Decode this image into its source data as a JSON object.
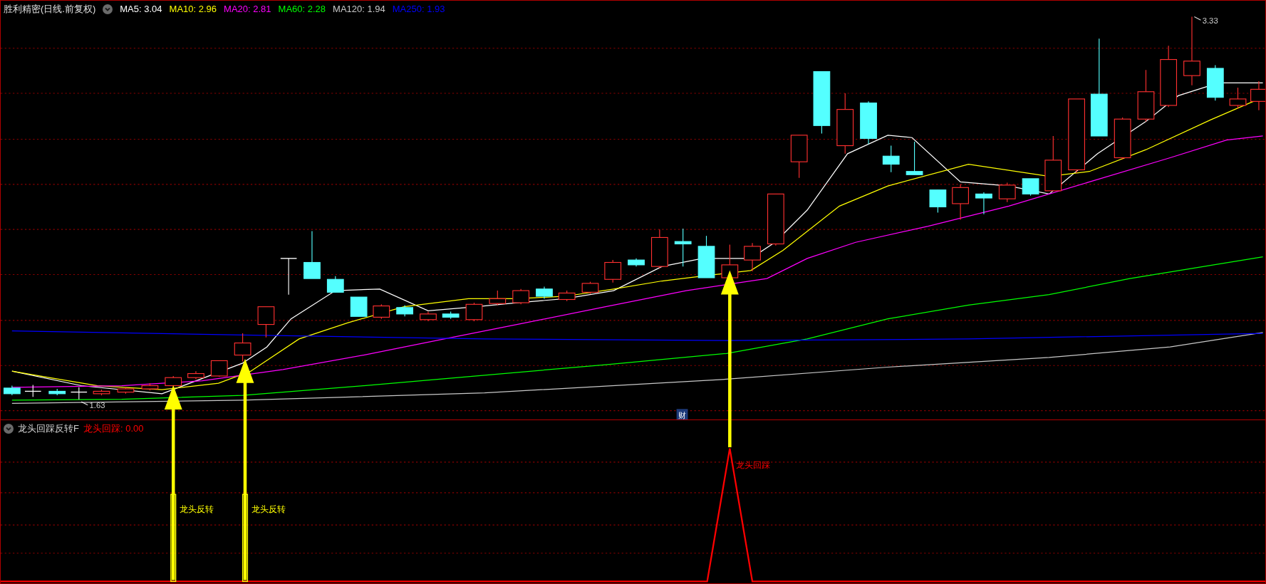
{
  "title": "胜利精密(日线.前复权)",
  "indicators": [
    {
      "label": "MA5: 3.04",
      "color": "#ffffff"
    },
    {
      "label": "MA10: 2.96",
      "color": "#ffff00"
    },
    {
      "label": "MA20: 2.81",
      "color": "#ff00ff"
    },
    {
      "label": "MA60: 2.28",
      "color": "#00ff00"
    },
    {
      "label": "MA120: 1.94",
      "color": "#c8c8c8"
    },
    {
      "label": "MA250: 1.93",
      "color": "#0000ff"
    }
  ],
  "price_labels": {
    "high": "3.33",
    "low": "1.63"
  },
  "event_marker": "财",
  "sub_panel": {
    "title": "龙头回踩反转F",
    "readout": "龙头回踩: 0.00",
    "signals": [
      {
        "kind": "reversal",
        "label": "龙头反转"
      },
      {
        "kind": "reversal",
        "label": "龙头反转"
      },
      {
        "kind": "pullback",
        "label": "龙头回踩"
      }
    ]
  }
}
